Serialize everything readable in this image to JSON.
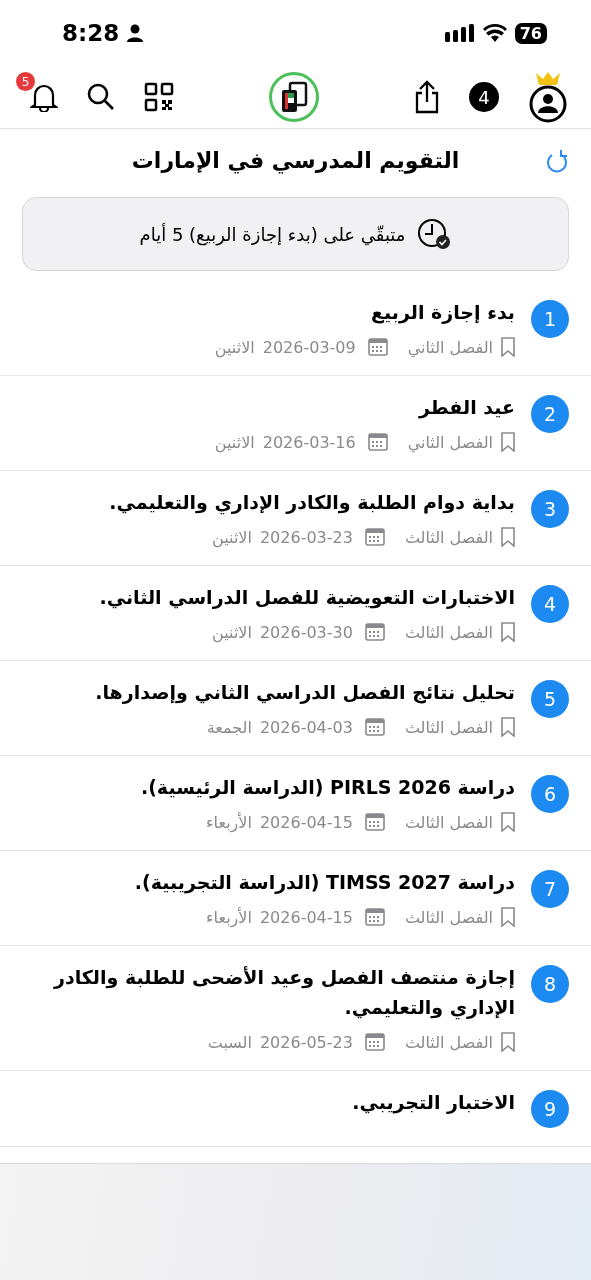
{
  "status_bar": {
    "time": "8:28",
    "battery": "76"
  },
  "header": {
    "notifications_badge": "5",
    "counter": "4"
  },
  "page": {
    "title": "التقويم المدرسي في الإمارات"
  },
  "countdown": {
    "text": "متبقّي على (بدء إجازة الربيع) 5 أيام"
  },
  "events": [
    {
      "number": "1",
      "title": "بدء إجازة الربيع",
      "term": "الفصل الثاني",
      "date": "2026-03-09",
      "day": "الاثنين"
    },
    {
      "number": "2",
      "title": "عيد الفطر",
      "term": "الفصل الثاني",
      "date": "2026-03-16",
      "day": "الاثنين"
    },
    {
      "number": "3",
      "title": "بداية دوام الطلبة والكادر الإداري والتعليمي.",
      "term": "الفصل الثالث",
      "date": "2026-03-23",
      "day": "الاثنين"
    },
    {
      "number": "4",
      "title": "الاختبارات التعويضية للفصل الدراسي الثاني.",
      "term": "الفصل الثالث",
      "date": "2026-03-30",
      "day": "الاثنين"
    },
    {
      "number": "5",
      "title": "تحليل نتائج الفصل الدراسي الثاني وإصدارها.",
      "term": "الفصل الثالث",
      "date": "2026-04-03",
      "day": "الجمعة"
    },
    {
      "number": "6",
      "title": "دراسة PIRLS 2026 (الدراسة الرئيسية).",
      "term": "الفصل الثالث",
      "date": "2026-04-15",
      "day": "الأربعاء"
    },
    {
      "number": "7",
      "title": "دراسة TIMSS 2027 (الدراسة التجريبية).",
      "term": "الفصل الثالث",
      "date": "2026-04-15",
      "day": "الأربعاء"
    },
    {
      "number": "8",
      "title": "إجازة منتصف الفصل وعيد الأضحى للطلبة والكادر الإداري والتعليمي.",
      "term": "الفصل الثالث",
      "date": "2026-05-23",
      "day": "السبت"
    },
    {
      "number": "9",
      "title": "الاختبار التجريبي."
    }
  ]
}
